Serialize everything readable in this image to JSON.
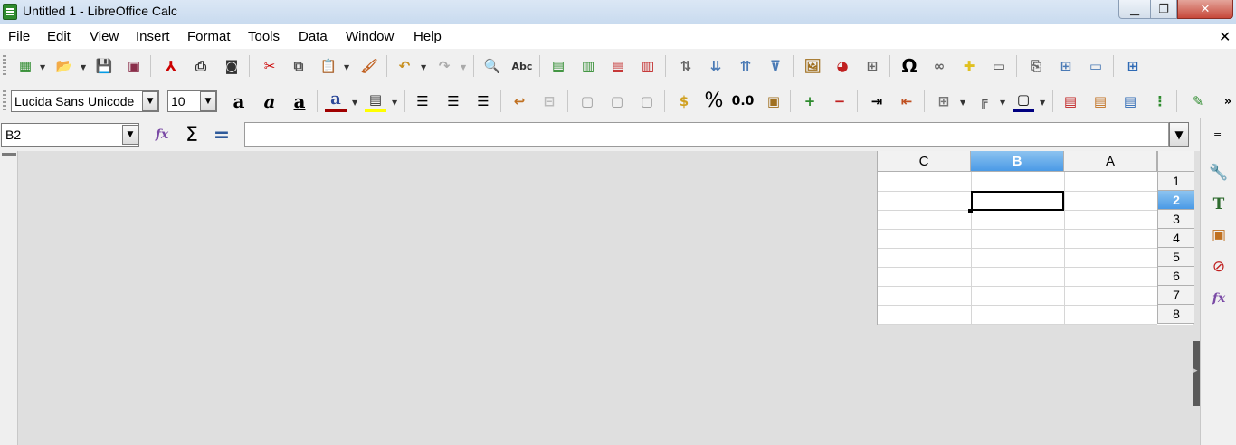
{
  "window": {
    "title": "Untitled 1 - LibreOffice Calc"
  },
  "menu": [
    "File",
    "Edit",
    "View",
    "Insert",
    "Format",
    "Tools",
    "Data",
    "Window",
    "Help"
  ],
  "formatting": {
    "font_name": "Lucida Sans Unicode",
    "font_size": "10"
  },
  "formula_bar": {
    "name_box": "B2",
    "formula": ""
  },
  "grid": {
    "columns": [
      "C",
      "B",
      "A"
    ],
    "rows": [
      "1",
      "2",
      "3",
      "4",
      "5",
      "6",
      "7",
      "8"
    ],
    "selected_cell": "B2",
    "selected_column": "B",
    "selected_row": "2"
  },
  "icons": {
    "std_toolbar": [
      "new-icon",
      "open-icon",
      "save-icon",
      "save-as-icon",
      "export-pdf-icon",
      "print-icon",
      "print-preview-icon",
      "cut-icon",
      "copy-icon",
      "paste-icon",
      "clone-formatting-icon",
      "undo-icon",
      "redo-icon",
      "find-replace-icon",
      "spelling-icon",
      "rows-icon",
      "columns-icon",
      "delete-rows-icon",
      "delete-columns-icon",
      "sort-ascending-icon",
      "sort-descending-icon",
      "sort-icon",
      "autofilter-icon",
      "insert-image-icon",
      "insert-chart-icon",
      "pivot-table-icon",
      "special-character-icon",
      "hyperlink-icon",
      "comment-icon",
      "headers-footers-icon",
      "define-print-area-icon",
      "freeze-rows-columns-icon",
      "split-window-icon",
      "show-draw-functions-icon"
    ],
    "colors": {
      "font_color": "#c00000",
      "highlight_color": "#ffff00",
      "border_color": "#000080",
      "accent_select": "#4a9ae6"
    }
  }
}
